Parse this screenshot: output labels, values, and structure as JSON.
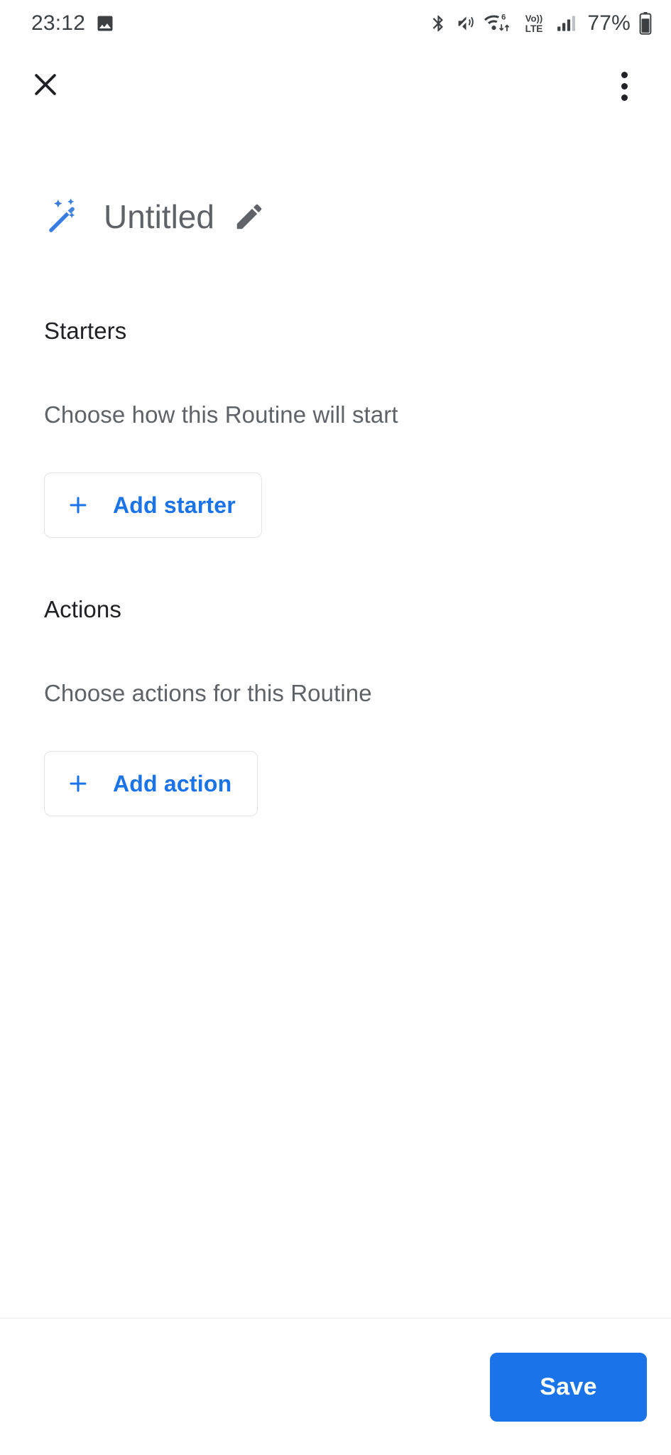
{
  "status_bar": {
    "clock": "23:12",
    "left_icons": [
      "image-icon"
    ],
    "right_icons": [
      "bluetooth-icon",
      "volume-mute-icon",
      "wifi-6-data-icon",
      "volte-icon",
      "cellular-signal-icon"
    ],
    "wifi_generation": "6",
    "volte_label_top": "Vo))",
    "volte_label_bottom": "LTE",
    "battery_percent": "77%"
  },
  "app_bar": {
    "close_icon": "close-icon",
    "overflow_icon": "more-vert-icon"
  },
  "routine": {
    "wand_icon": "magic-wand-icon",
    "title": "Untitled",
    "edit_icon": "pencil-edit-icon"
  },
  "starters": {
    "heading": "Starters",
    "subtitle": "Choose how this Routine will start",
    "add_button": {
      "icon": "plus-icon",
      "label": "Add starter"
    }
  },
  "actions": {
    "heading": "Actions",
    "subtitle": "Choose actions for this Routine",
    "add_button": {
      "icon": "plus-icon",
      "label": "Add action"
    }
  },
  "bottom_bar": {
    "save_label": "Save"
  },
  "colors": {
    "accent_blue": "#1a73e8",
    "wand_blue": "#3b7ddd",
    "text_primary": "#202124",
    "text_secondary": "#5f6368",
    "border": "#e3e4e6",
    "background": "#ffffff"
  }
}
